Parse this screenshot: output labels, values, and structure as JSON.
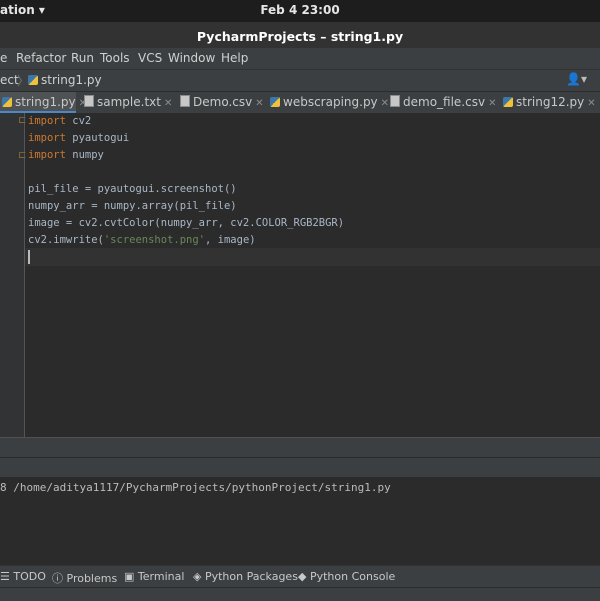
{
  "topbar": {
    "activities": "ation",
    "clock": "Feb 4  23:00"
  },
  "window": {
    "title": "PycharmProjects – string1.py"
  },
  "menu": {
    "items": [
      "e",
      "Refactor",
      "Run",
      "Tools",
      "VCS",
      "Window",
      "Help"
    ]
  },
  "nav": {
    "project": "ect",
    "file": "string1.py",
    "user_icon": "user-icon"
  },
  "tabs": [
    {
      "label": "string1.py",
      "icon": "python-file-icon",
      "active": true
    },
    {
      "label": "sample.txt",
      "icon": "text-file-icon"
    },
    {
      "label": "Demo.csv",
      "icon": "csv-file-icon"
    },
    {
      "label": "webscraping.py",
      "icon": "python-file-icon"
    },
    {
      "label": "demo_file.csv",
      "icon": "csv-file-icon"
    },
    {
      "label": "string12.py",
      "icon": "python-file-icon"
    }
  ],
  "editor": {
    "lines": [
      {
        "kw": "import",
        "rest": " cv2"
      },
      {
        "kw": "import",
        "rest": " pyautogui"
      },
      {
        "kw": "import",
        "rest": " numpy"
      },
      {
        "text": ""
      },
      {
        "text": "pil_file = pyautogui.screenshot()"
      },
      {
        "text": "numpy_arr = numpy.array(pil_file)"
      },
      {
        "pre": "image = cv2.cvtColor(numpy_arr, cv2.COLOR_RGB2BGR)"
      },
      {
        "pre": "cv2.imwrite(",
        "str": "'screenshot.png'",
        "post": ", image)"
      }
    ]
  },
  "run": {
    "output": "8 /home/aditya1117/PycharmProjects/pythonProject/string1.py"
  },
  "bottom_tabs": [
    {
      "label": "TODO",
      "icon": "list-icon"
    },
    {
      "label": "Problems",
      "icon": "problems-icon"
    },
    {
      "label": "Terminal",
      "icon": "terminal-icon"
    },
    {
      "label": "Python Packages",
      "icon": "packages-icon"
    },
    {
      "label": "Python Console",
      "icon": "python-console-icon"
    }
  ],
  "colors": {
    "keyword": "#cc7832",
    "string": "#6a8759",
    "code": "#a9b7c6",
    "tab_underline": "#4a88c7"
  }
}
